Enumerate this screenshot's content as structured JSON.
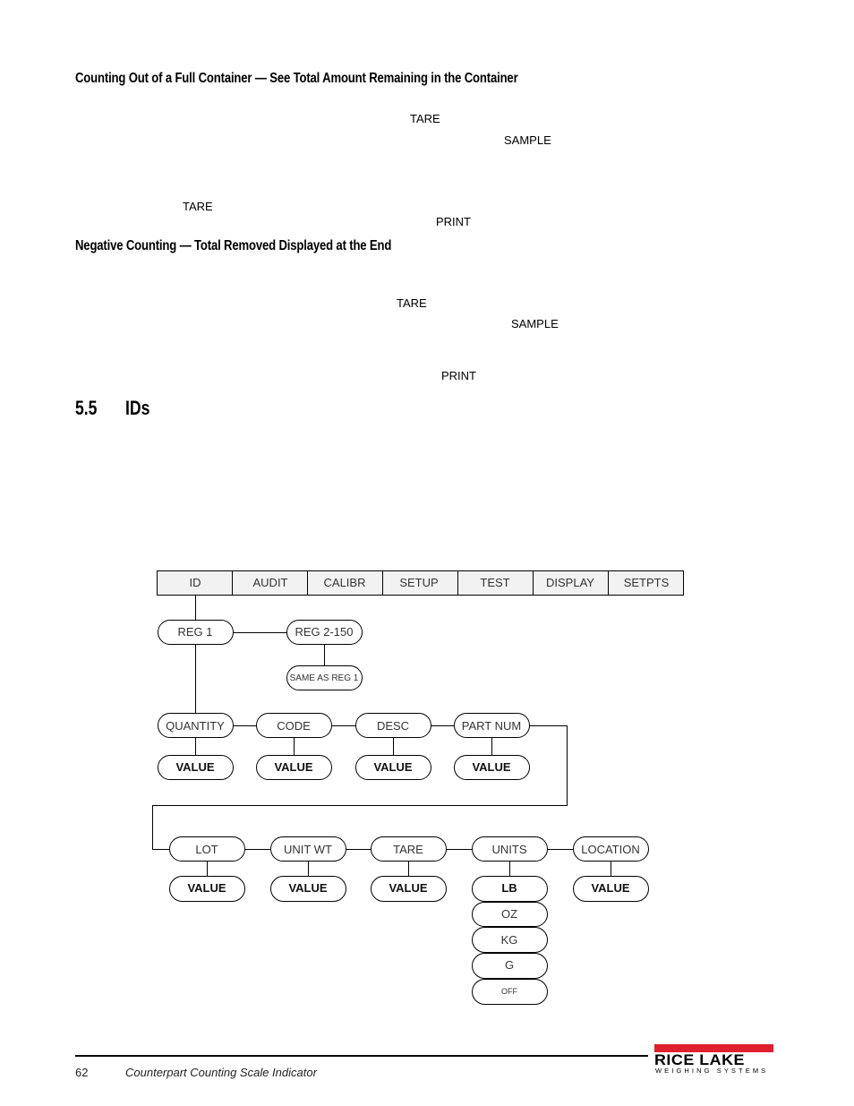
{
  "section1": {
    "heading": "Counting Out of a Full Container — See Total Amount Remaining in the Container",
    "keys": [
      "TARE",
      "SAMPLE",
      "TARE",
      "PRINT"
    ]
  },
  "section2": {
    "heading": "Negative Counting — Total Removed Displayed at the End",
    "keys": [
      "TARE",
      "SAMPLE",
      "PRINT"
    ]
  },
  "section3": {
    "number": "5.5",
    "title": "IDs"
  },
  "diagram": {
    "menu": [
      "ID",
      "AUDIT",
      "CALIBR",
      "SETUP",
      "TEST",
      "DISPLAY",
      "SETPTS"
    ],
    "reg1": "REG 1",
    "reg2": "REG 2-150",
    "same_as": "SAME AS REG 1",
    "row1": [
      {
        "label": "QUANTITY",
        "value": "VALUE"
      },
      {
        "label": "CODE",
        "value": "VALUE"
      },
      {
        "label": "DESC",
        "value": "VALUE"
      },
      {
        "label": "PART NUM",
        "value": "VALUE"
      }
    ],
    "row2": [
      {
        "label": "LOT",
        "value": "VALUE"
      },
      {
        "label": "UNIT WT",
        "value": "VALUE"
      },
      {
        "label": "TARE",
        "value": "VALUE"
      },
      {
        "label": "UNITS",
        "value": "LB"
      },
      {
        "label": "LOCATION",
        "value": "VALUE"
      }
    ],
    "units_options": [
      "OZ",
      "KG",
      "G",
      "OFF"
    ]
  },
  "footer": {
    "page_number": "62",
    "doc_title": "Counterpart Counting Scale Indicator",
    "logo_main": "RICE LAKE",
    "logo_sub": "WEIGHING SYSTEMS",
    "logo_color": "#e0202e"
  }
}
